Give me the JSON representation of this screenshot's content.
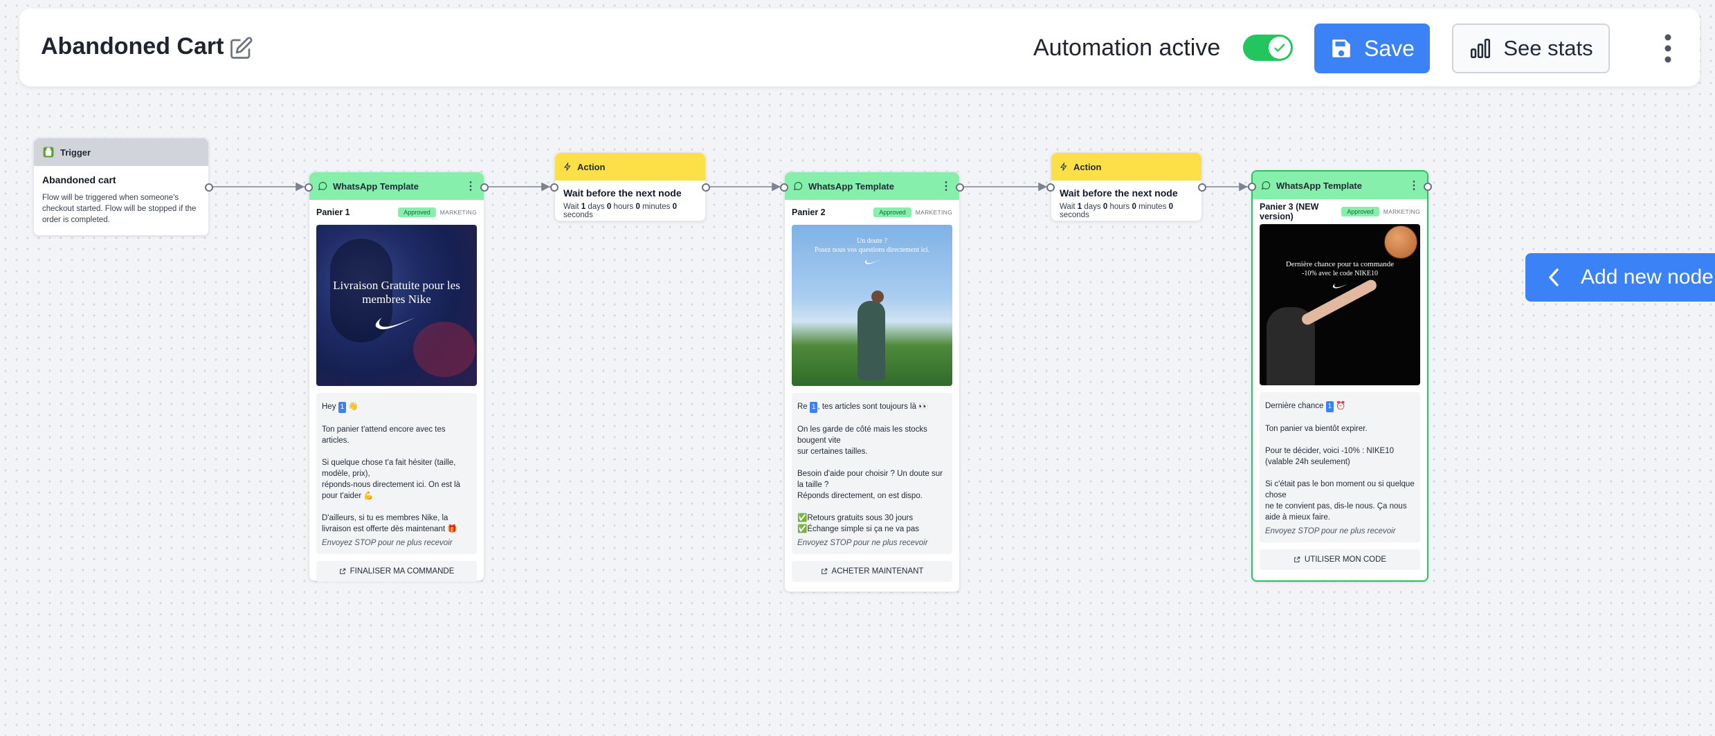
{
  "header": {
    "title": "Abandoned Cart",
    "automation_label": "Automation active",
    "automation_active": true,
    "save_label": "Save",
    "stats_label": "See stats"
  },
  "colors": {
    "accent": "#3b82f6",
    "toggle_on": "#22c55e",
    "trigger_header": "#d1d5db",
    "action_header": "#fde047",
    "whatsapp_header": "#86efac",
    "selected_border": "#22c55e"
  },
  "trigger": {
    "header": "Trigger",
    "title": "Abandoned cart",
    "description": "Flow will be triggered when someone's checkout started. Flow will be stopped if the order is completed."
  },
  "actions": [
    {
      "header": "Action",
      "title": "Wait before the next node",
      "wait_prefix": "Wait",
      "days": "1",
      "days_label": "days",
      "hours": "0",
      "hours_label": "hours",
      "minutes": "0",
      "minutes_label": "minutes",
      "seconds": "0",
      "seconds_label": "seconds"
    },
    {
      "header": "Action",
      "title": "Wait before the next node",
      "wait_prefix": "Wait",
      "days": "1",
      "days_label": "days",
      "hours": "0",
      "hours_label": "hours",
      "minutes": "0",
      "minutes_label": "minutes",
      "seconds": "0",
      "seconds_label": "seconds"
    }
  ],
  "templates": [
    {
      "header": "WhatsApp Template",
      "name": "Panier 1",
      "status": "Approved",
      "category": "MARKETING",
      "image_caption": "Livraison Gratuite pour les membres Nike",
      "lines": {
        "l1_pre": "Hey",
        "l1_var": "1",
        "l1_post": "👋",
        "l2": "Ton panier t'attend encore avec tes articles.",
        "l3": "Si quelque chose t'a fait hésiter (taille, modèle, prix),",
        "l4": "réponds-nous directement ici. On est là pour t'aider 💪",
        "l5": "D'ailleurs, si tu es membres Nike, la livraison est offerte dès maintenant 🎁"
      },
      "footer": "Envoyez STOP pour ne plus recevoir",
      "button": "FINALISER MA COMMANDE"
    },
    {
      "header": "WhatsApp Template",
      "name": "Panier 2",
      "status": "Approved",
      "category": "MARKETING",
      "image_caption_1": "Un doute ?",
      "image_caption_2": "Posez nous vos questions directement ici.",
      "lines": {
        "l1_pre": "Re",
        "l1_var": "1",
        "l1_post": ", tes articles sont toujours là 👀",
        "l2": "On les garde de côté mais les stocks bougent vite",
        "l3": "sur certaines tailles.",
        "l4": "Besoin d'aide pour choisir ? Un doute sur la taille ?",
        "l5": "Réponds directement, on est dispo.",
        "l6": "✅Retours gratuits sous 30 jours",
        "l7": "✅Échange simple si ça ne va pas"
      },
      "footer": "Envoyez STOP pour ne plus recevoir",
      "button": "ACHETER MAINTENANT"
    },
    {
      "header": "WhatsApp Template",
      "name": "Panier 3 (NEW version)",
      "status": "Approved",
      "category": "MARKETING",
      "image_caption_1": "Dernière chance pour ta commande",
      "image_caption_2": "-10% avec le code NIKE10",
      "lines": {
        "l1_pre": "Dernière chance",
        "l1_var": "1",
        "l1_post": "⏰",
        "l2": "Ton panier va bientôt expirer.",
        "l3": "Pour te décider, voici -10% : NIKE10",
        "l4": "(valable 24h seulement)",
        "l5": "Si c'était pas le bon moment ou si quelque chose",
        "l6": "ne te convient pas, dis-le nous. Ça nous aide à mieux faire."
      },
      "footer": "Envoyez STOP pour ne plus recevoir",
      "button": "UTILISER MON CODE"
    }
  ],
  "add_node_label": "Add new node"
}
